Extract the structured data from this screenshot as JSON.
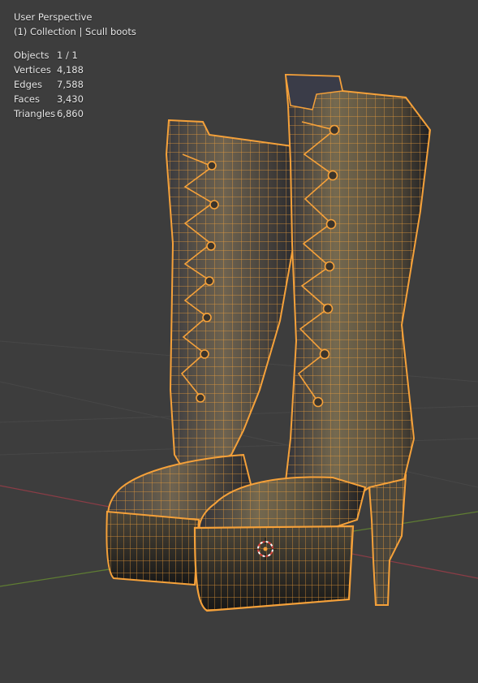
{
  "viewport": {
    "view_name": "User Perspective",
    "collection_line": "(1) Collection | Scull boots",
    "stats": [
      {
        "label": "Objects",
        "value": "1 / 1"
      },
      {
        "label": "Vertices",
        "value": "4,188"
      },
      {
        "label": "Edges",
        "value": "7,588"
      },
      {
        "label": "Faces",
        "value": "3,430"
      },
      {
        "label": "Triangles",
        "value": "6,860"
      }
    ]
  },
  "colors": {
    "background": "#3d3d3d",
    "wireframe_selected": "#f5a13a",
    "x_axis": "#8a3d46",
    "y_axis": "#5f7d33",
    "leather": "#4a4438"
  }
}
